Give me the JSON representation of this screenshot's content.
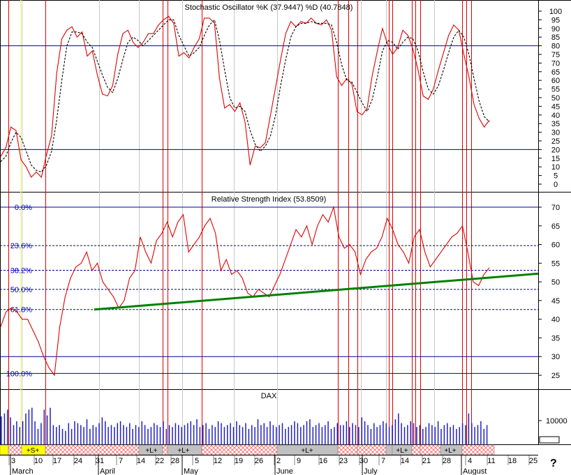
{
  "chart_data": [
    {
      "panel": "stochastic",
      "type": "line",
      "title": "Stochastic Oscillator %K (37.9447) %D (40.7848)",
      "ylim": [
        0,
        100
      ],
      "yticks": [
        0,
        5,
        10,
        15,
        20,
        25,
        30,
        35,
        40,
        45,
        50,
        55,
        60,
        65,
        70,
        75,
        80,
        85,
        90,
        95,
        100
      ],
      "levels": [
        80,
        20
      ],
      "series": [
        {
          "name": "%K",
          "color": "#e00000",
          "values": [
            16,
            21,
            33,
            31,
            14,
            10,
            4,
            7,
            4,
            17,
            28,
            64,
            84,
            89,
            91,
            85,
            88,
            74,
            77,
            63,
            52,
            51,
            57,
            75,
            87,
            89,
            82,
            79,
            82,
            87,
            87,
            92,
            95,
            97,
            93,
            74,
            76,
            73,
            79,
            84,
            96,
            96,
            93,
            61,
            44,
            46,
            42,
            47,
            36,
            11,
            22,
            21,
            24,
            40,
            56,
            72,
            87,
            94,
            91,
            94,
            93,
            96,
            93,
            92,
            95,
            89,
            62,
            57,
            61,
            58,
            42,
            40,
            44,
            63,
            77,
            90,
            81,
            75,
            79,
            89,
            86,
            78,
            66,
            51,
            49,
            55,
            66,
            76,
            86,
            92,
            89,
            75,
            62,
            46,
            38,
            33,
            37
          ]
        },
        {
          "name": "%D",
          "color": "#000000",
          "values": [
            13,
            16,
            24,
            30,
            27,
            19,
            11,
            8,
            7,
            11,
            19,
            37,
            60,
            80,
            88,
            88,
            87,
            82,
            79,
            71,
            63,
            56,
            53,
            61,
            72,
            82,
            85,
            83,
            80,
            83,
            86,
            89,
            92,
            95,
            95,
            86,
            80,
            74,
            76,
            79,
            86,
            92,
            95,
            83,
            66,
            50,
            44,
            45,
            42,
            31,
            23,
            19,
            22,
            28,
            40,
            57,
            72,
            85,
            91,
            93,
            93,
            94,
            93,
            93,
            93,
            92,
            82,
            69,
            60,
            59,
            53,
            47,
            42,
            49,
            62,
            77,
            83,
            82,
            78,
            82,
            85,
            84,
            77,
            65,
            55,
            52,
            57,
            66,
            76,
            85,
            89,
            85,
            75,
            61,
            48,
            39,
            36
          ]
        }
      ]
    },
    {
      "panel": "rsi",
      "type": "line",
      "title": "Relative Strength Index (53.8509)",
      "ylim": [
        22,
        73
      ],
      "yticks": [
        25,
        30,
        35,
        40,
        45,
        50,
        55,
        60,
        65,
        70
      ],
      "levels": [
        30,
        70
      ],
      "fibonacci": [
        {
          "label": "0.0%",
          "value": 70
        },
        {
          "label": "23.6%",
          "value": 59.7
        },
        {
          "label": "38.2%",
          "value": 53.1
        },
        {
          "label": "50.0%",
          "value": 48.0
        },
        {
          "label": "61.8%",
          "value": 42.6
        },
        {
          "label": "100.0%",
          "value": 25.5
        }
      ],
      "trendline": {
        "color": "#008000",
        "from": {
          "bar": 31,
          "value": 42.6
        },
        "to": {
          "bar": 168,
          "value": 52.2
        }
      },
      "series": [
        {
          "name": "RSI",
          "color": "#e00000",
          "values": [
            38,
            42,
            43,
            42,
            40,
            40,
            37,
            34,
            30,
            27,
            25,
            38,
            46,
            51,
            54,
            55,
            58,
            53,
            55,
            50,
            48,
            46,
            43,
            45,
            51,
            53,
            62,
            58,
            55,
            61,
            63,
            66,
            62,
            66,
            68,
            58,
            60,
            62,
            65,
            67,
            63,
            53,
            56,
            52,
            53,
            51,
            47,
            46,
            48,
            47,
            46,
            49,
            52,
            56,
            60,
            64,
            62,
            65,
            60,
            65,
            68,
            66,
            70,
            62,
            59,
            60,
            58,
            52,
            56,
            58,
            59,
            62,
            67,
            64,
            60,
            58,
            55,
            62,
            64,
            58,
            54,
            56,
            58,
            60,
            62,
            63,
            65,
            58,
            50,
            49,
            52,
            53.8
          ]
        }
      ]
    },
    {
      "panel": "volume",
      "type": "bar",
      "title": "DAX",
      "yticks": [
        10000
      ],
      "values": [
        14.5,
        16,
        18,
        14,
        10,
        12,
        9,
        12,
        16,
        18,
        19,
        12,
        8,
        11,
        18,
        15,
        19,
        10,
        9,
        10,
        8,
        7,
        11,
        8,
        12,
        11,
        10,
        9,
        13,
        8,
        10,
        9,
        11,
        14,
        12,
        9,
        10,
        9,
        11,
        12,
        10,
        9,
        11,
        8,
        10,
        9,
        12,
        10,
        8,
        9,
        11,
        10,
        9,
        12,
        8,
        10,
        9,
        11,
        10,
        9,
        10,
        11,
        12,
        10,
        13,
        9,
        10,
        11,
        8,
        10,
        9,
        12,
        11,
        9,
        10,
        11,
        9,
        12,
        10,
        9,
        11,
        8,
        10,
        9,
        13,
        10,
        11,
        9,
        12,
        10,
        9,
        10,
        11,
        8,
        9,
        10,
        12,
        11,
        9,
        10,
        12,
        13,
        9,
        10,
        11,
        9,
        10,
        12,
        8,
        9,
        11,
        10,
        10,
        12,
        9,
        11,
        10,
        9,
        14,
        12,
        10,
        8,
        11,
        9,
        10,
        12,
        11,
        9,
        10,
        13,
        16,
        11,
        9,
        10,
        12,
        11,
        9,
        10,
        8,
        9,
        11,
        10,
        9,
        12,
        8,
        10,
        11,
        9,
        10,
        8,
        9,
        11,
        10,
        16,
        11,
        9,
        10,
        12,
        8,
        10
      ]
    }
  ],
  "volume_label": "10000",
  "x_axis": {
    "days": [
      "3",
      "10",
      "17",
      "24",
      "31",
      "7",
      "14",
      "22",
      "28",
      "5",
      "12",
      "19",
      "26",
      "2",
      "9",
      "16",
      "23",
      "30",
      "7",
      "14",
      "21",
      "28",
      "4",
      "11",
      "18",
      "25"
    ],
    "months": [
      "March",
      "April",
      "May",
      "June",
      "July",
      "August"
    ]
  },
  "signal_bar": {
    "labels": [
      "+S+",
      "+L+",
      "+L+",
      "+L+",
      "+L+",
      "+L+"
    ],
    "colors": {
      "signal_yellow": "#ffff00",
      "signal_gray": "#c0c0c0",
      "hatch": "#ff6060"
    }
  },
  "colors": {
    "red_line": "#e00000",
    "blue_line": "#0000a0",
    "volume_bar": "#2020c0",
    "trend": "#008000",
    "yellow_marker": "#ffff60"
  },
  "help_glyph": "?"
}
